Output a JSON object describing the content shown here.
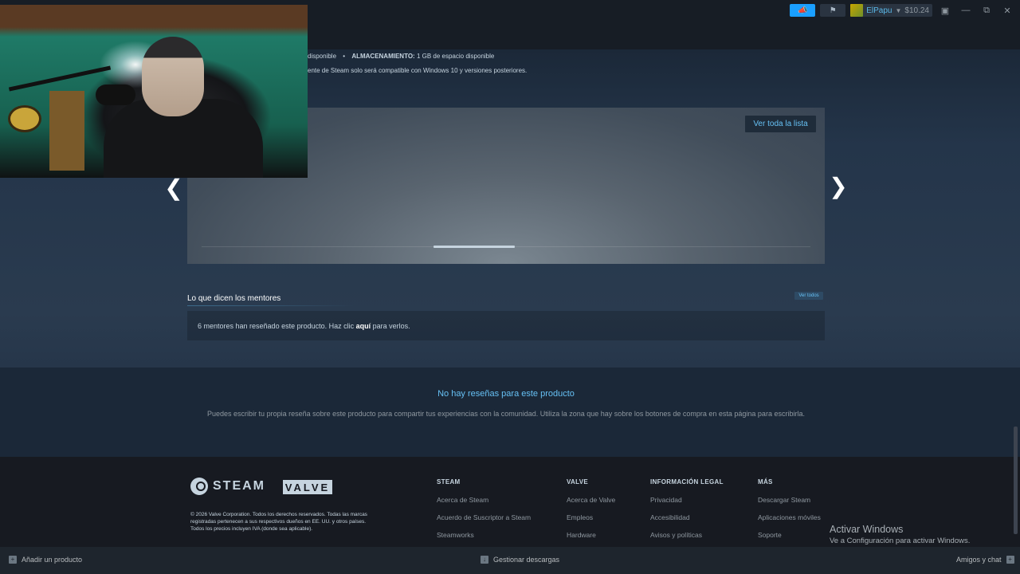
{
  "titlebar": {
    "username": "ElPapu",
    "balance": "$10.24",
    "announce_icon": "megaphone-icon",
    "bell_icon": "bell-icon",
    "window_controls": [
      "monitor-icon",
      "minimize-icon",
      "restore-icon",
      "close-icon"
    ]
  },
  "sysreq": {
    "storage_prefix": "disponible",
    "storage_label": "ALMACENAMIENTO:",
    "storage_value": "1 GB de espacio disponible",
    "windows_note": "ente de Steam solo será compatible con Windows 10 y versiones posteriores."
  },
  "carousel": {
    "view_all_label": "Ver toda la lista",
    "progress": 0.38
  },
  "curators": {
    "title": "Lo que dicen los mentores",
    "see_all_label": "Ver todos",
    "text_before": "6 mentores han reseñado este producto. Haz clic ",
    "link": "aquí",
    "text_after": " para verlos."
  },
  "reviews": {
    "title": "No hay reseñas para este producto",
    "description": "Puedes escribir tu propia reseña sobre este producto para compartir tus experiencias con la comunidad. Utiliza la zona que hay sobre los botones de compra en esta página para escribirla."
  },
  "footer": {
    "steam_logo": "STEAM",
    "valve_logo": "VALVE",
    "legal_line1": "© 2026 Valve Corporation. Todos los derechos reservados. Todas las marcas",
    "legal_line2": "registradas pertenecen a sus respectivos dueños en EE. UU. y otros países.",
    "legal_line3": "Todos los precios incluyen IVA (donde sea aplicable).",
    "columns": [
      {
        "heading": "STEAM",
        "links": [
          "Acerca de Steam",
          "Acuerdo de Suscriptor a Steam",
          "Steamworks"
        ]
      },
      {
        "heading": "VALVE",
        "links": [
          "Acerca de Valve",
          "Empleos",
          "Hardware"
        ]
      },
      {
        "heading": "INFORMACIÓN LEGAL",
        "links": [
          "Privacidad",
          "Accesibilidad",
          "Avisos y políticas"
        ]
      },
      {
        "heading": "MÁS",
        "links": [
          "Descargar Steam",
          "Aplicaciones móviles",
          "Soporte"
        ]
      }
    ]
  },
  "activation": {
    "title": "Activar Windows",
    "subtitle": "Ve a Configuración para activar Windows."
  },
  "bottombar": {
    "add_product": "Añadir un producto",
    "manage_downloads": "Gestionar descargas",
    "friends_chat": "Amigos y chat"
  }
}
